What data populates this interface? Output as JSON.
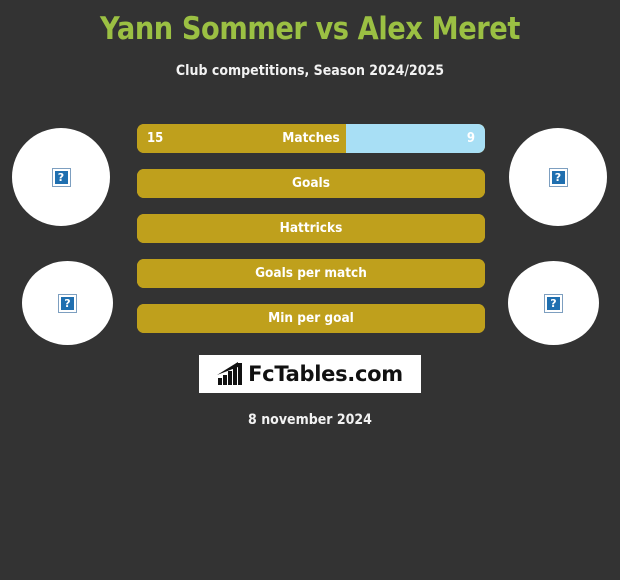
{
  "header": {
    "title": "Yann Sommer vs Alex Meret",
    "subtitle": "Club competitions, Season 2024/2025",
    "title_color": "#9bc043",
    "subtitle_color": "#f2f2f2"
  },
  "background_color": "#333333",
  "players": {
    "left": {
      "name": "Yann Sommer",
      "photo_alt": "?",
      "photo_status": "broken-image"
    },
    "right": {
      "name": "Alex Meret",
      "photo_alt": "?",
      "photo_status": "broken-image"
    }
  },
  "chart_data": {
    "type": "bar",
    "title": "Yann Sommer vs Alex Meret",
    "subtitle": "Club competitions, Season 2024/2025",
    "orientation": "horizontal-diverging",
    "series": [
      {
        "name": "Yann Sommer",
        "color": "#bfa01c",
        "side": "left"
      },
      {
        "name": "Alex Meret",
        "color": "#a8dff5",
        "side": "right"
      }
    ],
    "categories": [
      "Matches",
      "Goals",
      "Hattricks",
      "Goals per match",
      "Min per goal"
    ],
    "rows": [
      {
        "label": "Matches",
        "left_value": "15",
        "right_value": "9",
        "left_pct": 60,
        "right_pct": 40
      },
      {
        "label": "Goals",
        "left_value": "",
        "right_value": "",
        "left_pct": 100,
        "right_pct": 0
      },
      {
        "label": "Hattricks",
        "left_value": "",
        "right_value": "",
        "left_pct": 100,
        "right_pct": 0
      },
      {
        "label": "Goals per match",
        "left_value": "",
        "right_value": "",
        "left_pct": 100,
        "right_pct": 0
      },
      {
        "label": "Min per goal",
        "left_value": "",
        "right_value": "",
        "left_pct": 100,
        "right_pct": 0
      }
    ]
  },
  "logo": {
    "text": "FcTables.com",
    "icon": "bar-chart-trend-icon",
    "background_color": "#ffffff",
    "text_color": "#111111"
  },
  "footer": {
    "date": "8 november 2024"
  }
}
